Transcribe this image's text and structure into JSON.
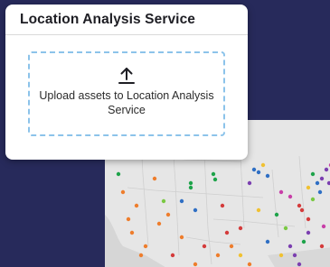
{
  "panel": {
    "title": "Location Analysis Service",
    "dropzone_text": "Upload assets to Location Analysis Service"
  },
  "icons": {
    "upload": "upload-arrow-icon"
  },
  "colors": {
    "background": "#272a5b",
    "dropzone_border": "#8cc3ea",
    "map_land": "#e9e9e9",
    "marker_colors": [
      "#ee7d2c",
      "#1ea34a",
      "#2f6fc4",
      "#d43b3b",
      "#7b3fb0",
      "#f0c132",
      "#c83fa8",
      "#7ac943"
    ]
  }
}
